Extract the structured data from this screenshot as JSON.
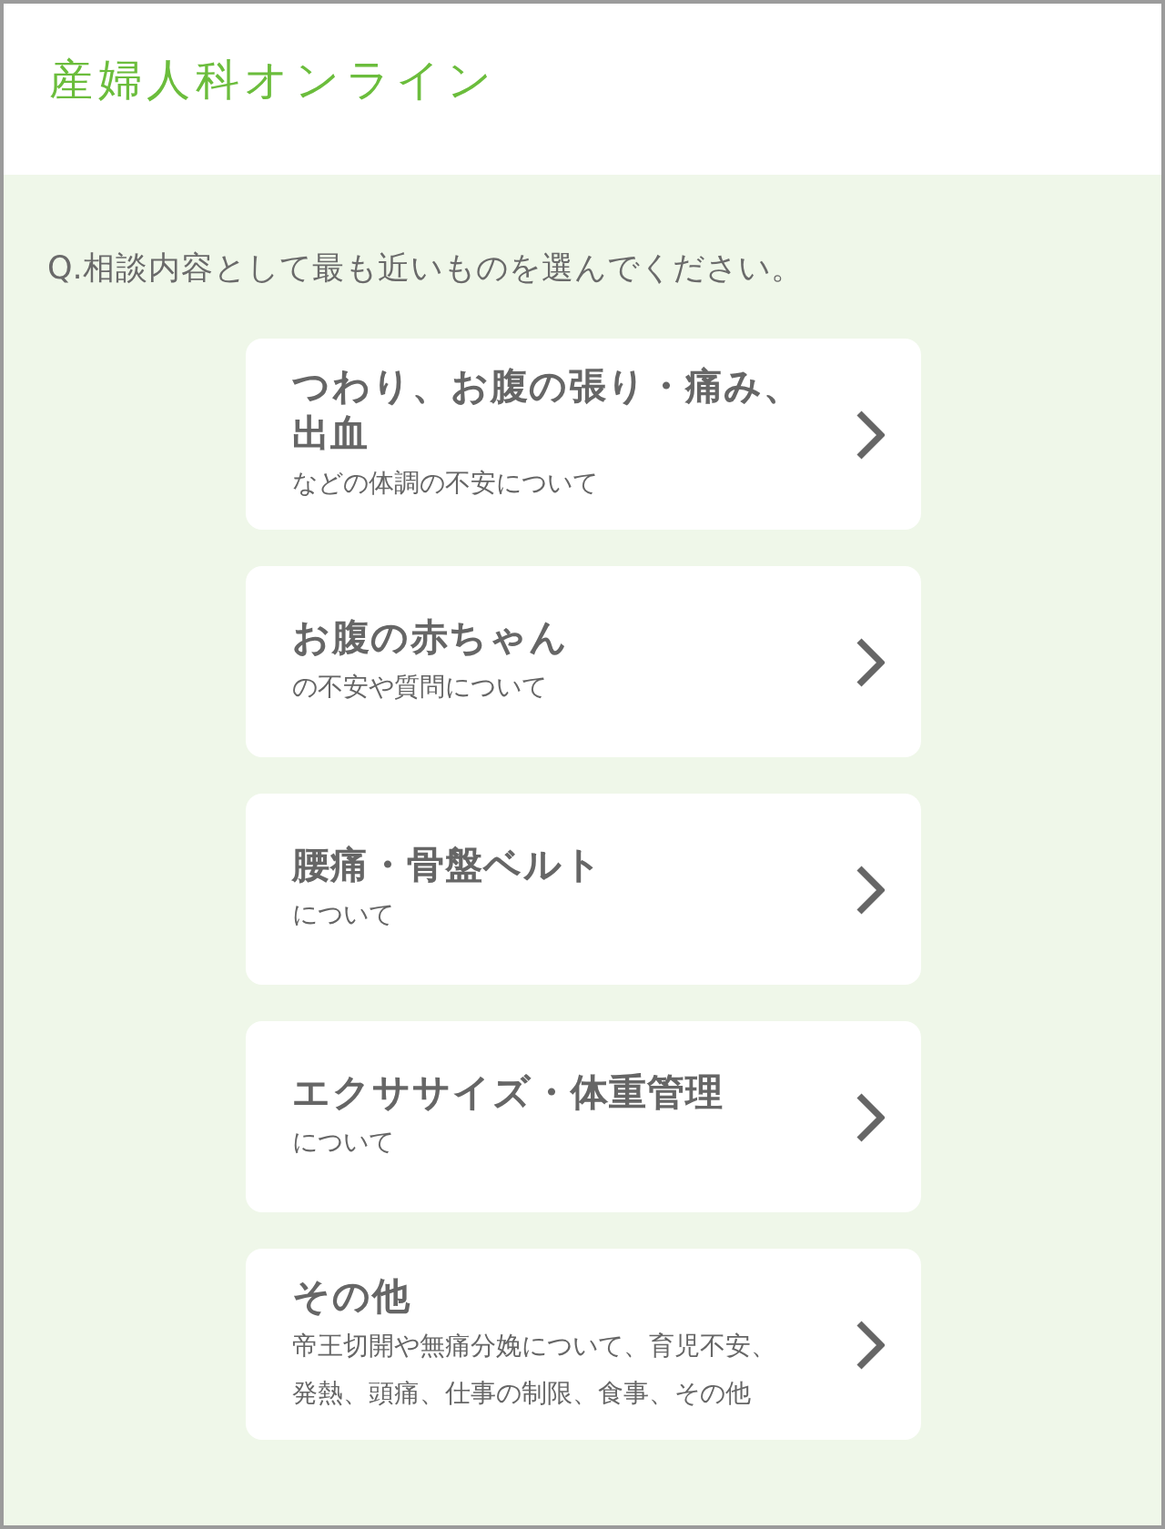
{
  "header": {
    "logo": "産婦人科オンライン"
  },
  "question": "Q.相談内容として最も近いものを選んでください。",
  "options": [
    {
      "title": "つわり、お腹の張り・痛み、出血",
      "subtitle": "などの体調の不安について"
    },
    {
      "title": "お腹の赤ちゃん",
      "subtitle": "の不安や質問について"
    },
    {
      "title": "腰痛・骨盤ベルト",
      "subtitle": "について"
    },
    {
      "title": "エクササイズ・体重管理",
      "subtitle": "について"
    },
    {
      "title": "その他",
      "subtitle": "帝王切開や無痛分娩について、育児不安、発熱、頭痛、仕事の制限、食事、その他"
    }
  ]
}
